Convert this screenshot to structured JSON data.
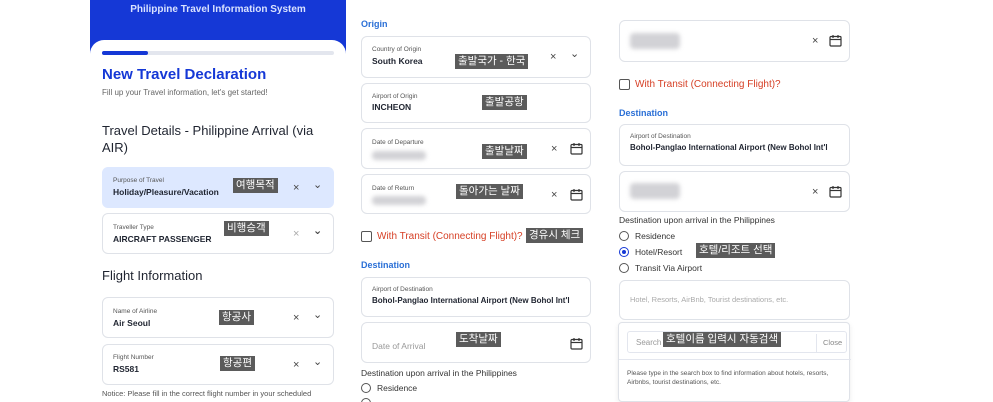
{
  "panel1": {
    "hero_title": "Philippine Travel Information System",
    "progress_fraction": 0.2,
    "title": "New Travel Declaration",
    "subtitle": "Fill up your Travel information, let's get started!",
    "section_travel": "Travel Details - Philippine Arrival (via AIR)",
    "purpose": {
      "label": "Purpose of Travel",
      "value": "Holiday/Pleasure/Vacation",
      "note": "여행목적"
    },
    "traveller": {
      "label": "Traveller Type",
      "value": "AIRCRAFT PASSENGER",
      "note": "비행승객"
    },
    "section_flight": "Flight Information",
    "airline": {
      "label": "Name of Airline",
      "value": "Air Seoul",
      "note": "항공사"
    },
    "flight_number": {
      "label": "Flight Number",
      "value": "RS581",
      "note": "항공편"
    },
    "notice": "Notice: Please fill in the correct flight number in your scheduled"
  },
  "panel2": {
    "section_origin": "Origin",
    "country_origin": {
      "label": "Country of Origin",
      "value": "South Korea",
      "note": "출발국가 - 한국"
    },
    "airport_origin": {
      "label": "Airport of Origin",
      "value": "INCHEON",
      "note": "출발공항"
    },
    "departure": {
      "label": "Date of Departure",
      "note": "출발날짜"
    },
    "return": {
      "label": "Date of Return",
      "note": "돌아가는 날짜"
    },
    "transit_label": "With Transit (Connecting Flight)?",
    "transit_note": "경유시 체크",
    "section_destination": "Destination",
    "airport_destination": {
      "label": "Airport of Destination",
      "value": "Bohol-Panglao International Airport (New Bohol Int'l"
    },
    "arrival": {
      "placeholder": "Date of Arrival",
      "note": "도착날짜"
    },
    "upon_arrival": "Destination upon arrival in the Philippines",
    "radio_residence": "Residence"
  },
  "panel3": {
    "transit_label": "With Transit (Connecting Flight)?",
    "section_destination": "Destination",
    "airport_destination": {
      "label": "Airport of Destination",
      "value": "Bohol-Panglao International Airport (New Bohol Int'l"
    },
    "upon_arrival": "Destination upon arrival in the Philippines",
    "radios": [
      "Residence",
      "Hotel/Resort",
      "Transit Via Airport"
    ],
    "selected_radio": "Hotel/Resort",
    "hotel_note": "호텔/리조트 선택",
    "hotel_placeholder": "Hotel, Resorts, AirBnb, Tourist destinations, etc.",
    "search_placeholder": "Search",
    "search_note": "호텔이름 입력시 자동검색",
    "close_label": "Close",
    "help_text": "Please type in the search box to find information about hotels, resorts, Airbnbs, tourist destinations, etc."
  },
  "icons": {
    "clear": "×",
    "chevron": "⌄",
    "calendar": "calendar-icon"
  },
  "colors": {
    "brand_blue": "#1538d6",
    "section_blue": "#2a6fd6",
    "transit_red": "#d64026",
    "filled_field": "#dde8ff",
    "annotation_bg": "#5b5b5b"
  }
}
